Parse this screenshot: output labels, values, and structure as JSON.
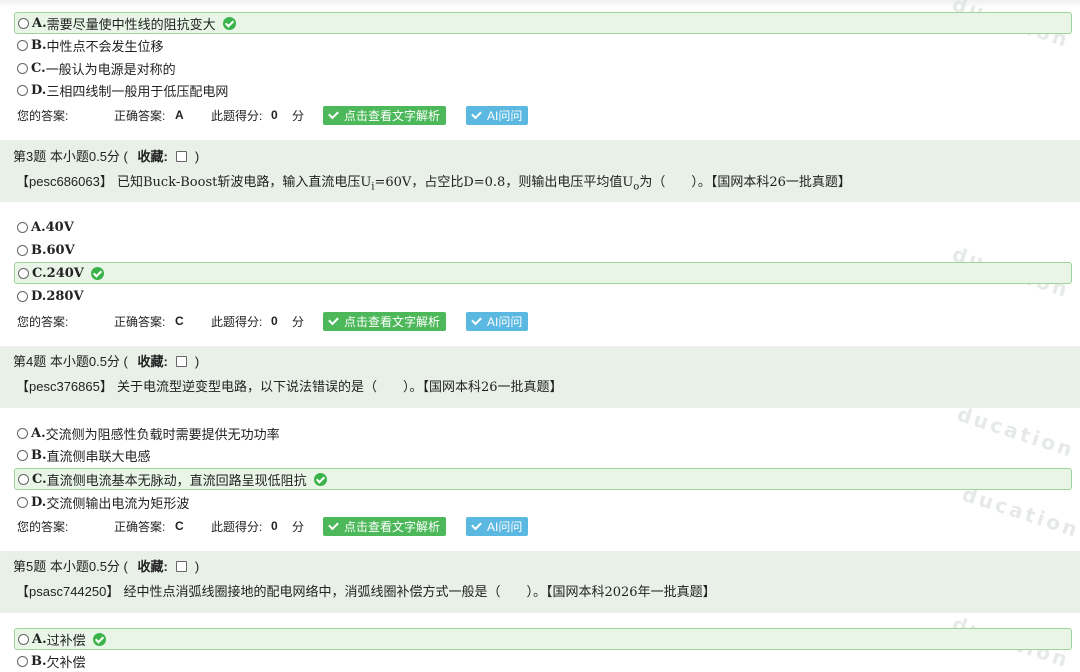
{
  "answer_labels": {
    "your_answer": "您的答案:",
    "correct_answer": "正确答案:",
    "score": "此题得分:",
    "score_unit": "分",
    "analysis_button": "点击查看文字解析",
    "ai_button": "AI问问"
  },
  "q2": {
    "options": [
      {
        "letter": "A.",
        "text": "需要尽量使中性线的阻抗变大",
        "correct": true
      },
      {
        "letter": "B.",
        "text": "中性点不会发生位移"
      },
      {
        "letter": "C.",
        "text": "一般认为电源是对称的"
      },
      {
        "letter": "D.",
        "text": "三相四线制一般用于低压配电网"
      }
    ],
    "correct_answer": "A",
    "score": "0"
  },
  "q3": {
    "number": "第3题",
    "points": "本小题0.5分 (",
    "favorite": "收藏:",
    "close": ")",
    "id": "【pesc686063】",
    "text_a": "已知Buck-Boost斩波电路，输入直流电压U",
    "sub_i": "i",
    "text_b": "=60V，占空比D=0.8，则输出电压平均值U",
    "sub_o": "o",
    "text_c": "为（　　）。【国网本科26一批真题】",
    "options": [
      {
        "letter": "A.",
        "text": "40V"
      },
      {
        "letter": "B.",
        "text": "60V"
      },
      {
        "letter": "C.",
        "text": "240V",
        "correct": true
      },
      {
        "letter": "D.",
        "text": "280V"
      }
    ],
    "correct_answer": "C",
    "score": "0"
  },
  "q4": {
    "number": "第4题",
    "points": "本小题0.5分 (",
    "favorite": "收藏:",
    "close": ")",
    "id": "【pesc376865】",
    "text": "关于电流型逆变型电路，以下说法错误的是（　　）。【国网本科26一批真题】",
    "options": [
      {
        "letter": "A.",
        "text": "交流侧为阻感性负载时需要提供无功功率"
      },
      {
        "letter": "B.",
        "text": "直流侧串联大电感"
      },
      {
        "letter": "C.",
        "text": "直流侧电流基本无脉动，直流回路呈现低阻抗",
        "correct": true
      },
      {
        "letter": "D.",
        "text": "交流侧输出电流为矩形波"
      }
    ],
    "correct_answer": "C",
    "score": "0"
  },
  "q5": {
    "number": "第5题",
    "points": "本小题0.5分 (",
    "favorite": "收藏:",
    "close": ")",
    "id": "【psasc744250】",
    "text": "经中性点消弧线圈接地的配电网络中，消弧线圈补偿方式一般是（　　）。【国网本科2026年一批真题】",
    "options": [
      {
        "letter": "A.",
        "text": "过补偿",
        "correct": true
      },
      {
        "letter": "B.",
        "text": "欠补偿"
      }
    ]
  }
}
